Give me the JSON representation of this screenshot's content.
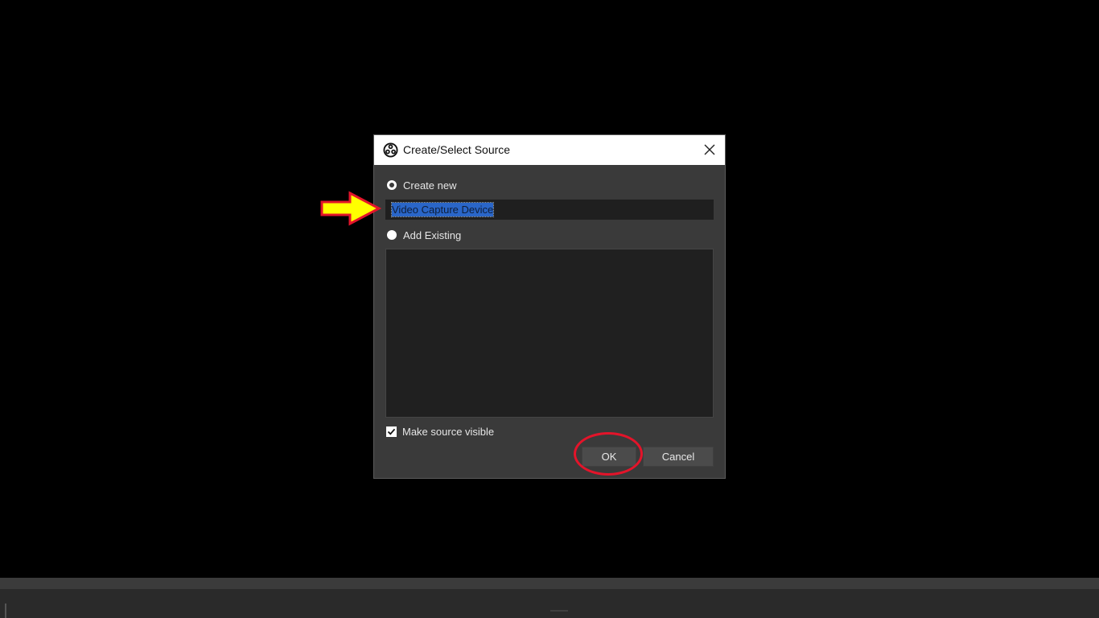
{
  "dialog": {
    "title": "Create/Select Source",
    "app_icon": "obs-logo-icon",
    "close_icon": "close-icon",
    "create_new": {
      "label": "Create new",
      "selected": true,
      "name_value": "Video Capture Device"
    },
    "add_existing": {
      "label": "Add Existing",
      "selected": false,
      "items": []
    },
    "make_visible": {
      "label": "Make source visible",
      "checked": true
    },
    "buttons": {
      "ok": "OK",
      "cancel": "Cancel"
    }
  },
  "annotations": {
    "arrow_color": "#ffff00",
    "arrow_outline": "#e3142a",
    "circle_color": "#e3142a"
  }
}
